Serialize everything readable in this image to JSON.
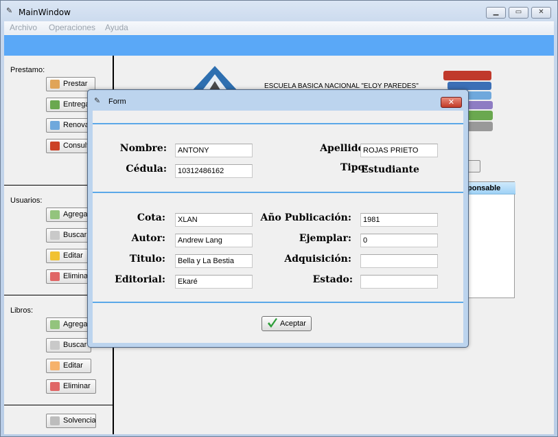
{
  "window": {
    "title": "MainWindow"
  },
  "menu": [
    "Archivo",
    "Operaciones",
    "Ayuda"
  ],
  "sidebar": {
    "prestamo": {
      "label": "Prestamo:",
      "buttons": [
        "Prestar",
        "Entrega",
        "Renova",
        "Consulta"
      ]
    },
    "usuarios": {
      "label": "Usuarios:",
      "buttons": [
        "Agrega",
        "Buscar",
        "Editar",
        "Eliminar"
      ]
    },
    "libros": {
      "label": "Libros:",
      "buttons": [
        "Agrega",
        "Buscar",
        "Editar",
        "Eliminar"
      ]
    },
    "solvencia": "Solvencia"
  },
  "content": {
    "school_text": "ESCUELA BASICA NACIONAL \"ELOY PAREDES\"",
    "table_header": "ponsable"
  },
  "form": {
    "title": "Form",
    "user": {
      "nombre_label": "Nombre:",
      "nombre_value": "ANTONY",
      "apellido_label": "Apellido:",
      "apellido_value": "ROJAS PRIETO",
      "cedula_label": "Cédula:",
      "cedula_value": "10312486162",
      "tipo_label": "Tipo:",
      "tipo_value": "Estudiante"
    },
    "book": {
      "cota_label": "Cota:",
      "cota_value": "XLAN",
      "anio_label": "Año Publicación:",
      "anio_value": "1981",
      "autor_label": "Autor:",
      "autor_value": "Andrew Lang",
      "ejemplar_label": "Ejemplar:",
      "ejemplar_value": "0",
      "titulo_label": "Titulo:",
      "titulo_value": "Bella y La Bestia",
      "adquisicion_label": "Adquisición:",
      "adquisicion_value": "",
      "editorial_label": "Editorial:",
      "editorial_value": "Ekaré",
      "estado_label": "Estado:",
      "estado_value": ""
    },
    "accept_label": "Aceptar"
  },
  "colors": {
    "accent_bar": "#5aa8f7",
    "separator": "#5aa8e8",
    "dialog_frame": "#bcd4ee"
  },
  "icons": [
    "app-icon",
    "minimize-icon",
    "maximize-icon",
    "close-icon",
    "check-icon"
  ]
}
